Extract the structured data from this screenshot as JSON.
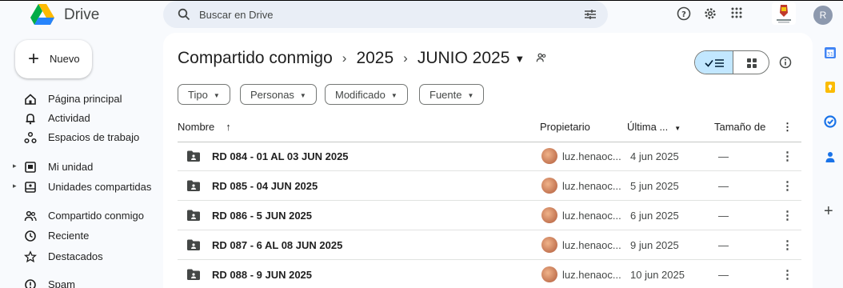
{
  "app": {
    "brand": "Drive",
    "avatar_letter": "R"
  },
  "search": {
    "placeholder": "Buscar en Drive"
  },
  "sidebar": {
    "new_label": "Nuevo",
    "items": [
      {
        "label": "Página principal",
        "icon": "home-icon"
      },
      {
        "label": "Actividad",
        "icon": "bell-icon"
      },
      {
        "label": "Espacios de trabajo",
        "icon": "workspaces-icon"
      },
      {
        "label": "Mi unidad",
        "icon": "my-drive-icon"
      },
      {
        "label": "Unidades compartidas",
        "icon": "shared-drives-icon"
      },
      {
        "label": "Compartido conmigo",
        "icon": "people-icon"
      },
      {
        "label": "Reciente",
        "icon": "clock-icon"
      },
      {
        "label": "Destacados",
        "icon": "star-icon"
      },
      {
        "label": "Spam",
        "icon": "spam-icon"
      }
    ]
  },
  "breadcrumb": {
    "root": "Compartido conmigo",
    "year": "2025",
    "current": "JUNIO 2025"
  },
  "filters": [
    "Tipo",
    "Personas",
    "Modificado",
    "Fuente"
  ],
  "table": {
    "columns": {
      "name": "Nombre",
      "owner": "Propietario",
      "modified": "Última ...",
      "size": "Tamaño de"
    },
    "rows": [
      {
        "name": "RD 084 - 01 AL 03 JUN 2025",
        "owner": "luz.henaoc...",
        "date": "4 jun 2025",
        "size": "—"
      },
      {
        "name": "RD 085 - 04 JUN 2025",
        "owner": "luz.henaoc...",
        "date": "5 jun 2025",
        "size": "—"
      },
      {
        "name": "RD 086 - 5 JUN 2025",
        "owner": "luz.henaoc...",
        "date": "6 jun 2025",
        "size": "—"
      },
      {
        "name": "RD 087 - 6 AL 08 JUN 2025",
        "owner": "luz.henaoc...",
        "date": "9 jun 2025",
        "size": "—"
      },
      {
        "name": "RD 088 - 9 JUN 2025",
        "owner": "luz.henaoc...",
        "date": "10 jun 2025",
        "size": "—"
      }
    ]
  },
  "colors": {
    "accent": "#0b57d0",
    "selected_view": "#c2e7ff",
    "background": "#f8fafd"
  }
}
